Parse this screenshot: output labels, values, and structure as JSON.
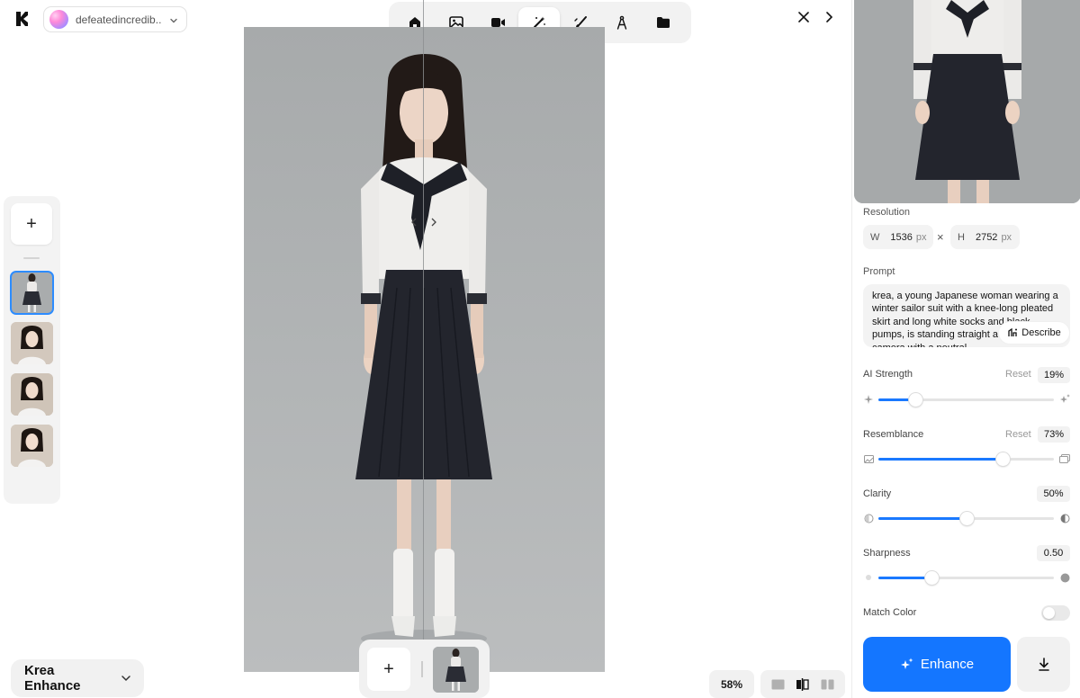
{
  "account": {
    "name": "defeatedincredib..."
  },
  "toolbar": {
    "tools": [
      "home-icon",
      "image-icon",
      "video-icon",
      "enhance-wand-icon",
      "edit-brush-icon",
      "train-compass-icon",
      "folder-icon"
    ],
    "active": "enhance-wand-icon"
  },
  "model_selector": {
    "label": "Krea Enhance"
  },
  "canvas": {
    "zoom": "58%"
  },
  "panel": {
    "resolution": {
      "label": "Resolution",
      "width_key": "W",
      "width_value": "1536",
      "width_unit": "px",
      "times": "×",
      "height_key": "H",
      "height_value": "2752",
      "height_unit": "px"
    },
    "prompt": {
      "label": "Prompt",
      "text": "krea, a young Japanese woman wearing a winter sailor suit with a knee-long pleated skirt and long white socks and black pumps, is standing straight a directly at the camera with a neutral",
      "describe_label": "Describe"
    },
    "ai_strength": {
      "label": "AI Strength",
      "reset": "Reset",
      "value": "19%",
      "fraction": 0.21
    },
    "resemblance": {
      "label": "Resemblance",
      "reset": "Reset",
      "value": "73%",
      "fraction": 0.71
    },
    "clarity": {
      "label": "Clarity",
      "value": "50%",
      "fraction": 0.5
    },
    "sharpness": {
      "label": "Sharpness",
      "value": "0.50",
      "fraction": 0.3
    },
    "match_color": {
      "label": "Match Color",
      "on": false
    },
    "enhance_label": "Enhance"
  },
  "colors": {
    "accent": "#1476ff",
    "slider_fill": "#1a79ff"
  }
}
